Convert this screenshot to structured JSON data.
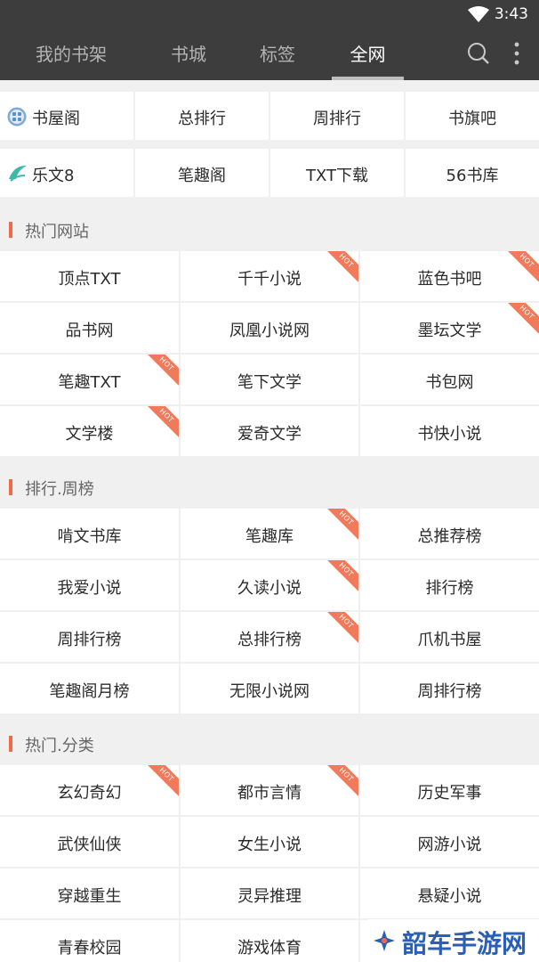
{
  "status_bar": {
    "time": "3:43"
  },
  "tabs": [
    {
      "label": "我的书架",
      "active": false
    },
    {
      "label": "书城",
      "active": false
    },
    {
      "label": "标签",
      "active": false
    },
    {
      "label": "全网",
      "active": true
    }
  ],
  "icons": {
    "search": "search-icon",
    "more": "more-vert-icon"
  },
  "top_rows": [
    [
      "书屋阁",
      "总排行",
      "周排行",
      "书旗吧"
    ],
    [
      "乐文8",
      "笔趣阁",
      "TXT下载",
      "56书库"
    ]
  ],
  "sections": [
    {
      "title": "热门网站",
      "items": [
        {
          "label": "顶点TXT",
          "hot": false
        },
        {
          "label": "千千小说",
          "hot": true
        },
        {
          "label": "蓝色书吧",
          "hot": true
        },
        {
          "label": "品书网",
          "hot": false
        },
        {
          "label": "凤凰小说网",
          "hot": false
        },
        {
          "label": "墨坛文学",
          "hot": true
        },
        {
          "label": "笔趣TXT",
          "hot": true
        },
        {
          "label": "笔下文学",
          "hot": false
        },
        {
          "label": "书包网",
          "hot": false
        },
        {
          "label": "文学楼",
          "hot": true
        },
        {
          "label": "爱奇文学",
          "hot": false
        },
        {
          "label": "书快小说",
          "hot": false
        }
      ]
    },
    {
      "title": "排行.周榜",
      "items": [
        {
          "label": "啃文书库",
          "hot": false
        },
        {
          "label": "笔趣库",
          "hot": true
        },
        {
          "label": "总推荐榜",
          "hot": false
        },
        {
          "label": "我爱小说",
          "hot": false
        },
        {
          "label": "久读小说",
          "hot": true
        },
        {
          "label": "排行榜",
          "hot": false
        },
        {
          "label": "周排行榜",
          "hot": false
        },
        {
          "label": "总排行榜",
          "hot": true
        },
        {
          "label": "爪机书屋",
          "hot": false
        },
        {
          "label": "笔趣阁月榜",
          "hot": false
        },
        {
          "label": "无限小说网",
          "hot": false
        },
        {
          "label": "周排行榜",
          "hot": false
        }
      ]
    },
    {
      "title": "热门.分类",
      "items": [
        {
          "label": "玄幻奇幻",
          "hot": true
        },
        {
          "label": "都市言情",
          "hot": true
        },
        {
          "label": "历史军事",
          "hot": false
        },
        {
          "label": "武侠仙侠",
          "hot": false
        },
        {
          "label": "女生小说",
          "hot": false
        },
        {
          "label": "网游小说",
          "hot": false
        },
        {
          "label": "穿越重生",
          "hot": false
        },
        {
          "label": "灵异推理",
          "hot": false
        },
        {
          "label": "悬疑小说",
          "hot": false
        },
        {
          "label": "青春校园",
          "hot": false
        },
        {
          "label": "游戏体育",
          "hot": false
        },
        {
          "label": "",
          "hot": false
        }
      ]
    }
  ],
  "hot_badge": "HOT",
  "watermark": "韶车手游网",
  "colors": {
    "appbar": "#3d3d3d",
    "accent": "#f06a4a",
    "hot": "#f07a5a",
    "watermark": "#2a5fb5"
  }
}
